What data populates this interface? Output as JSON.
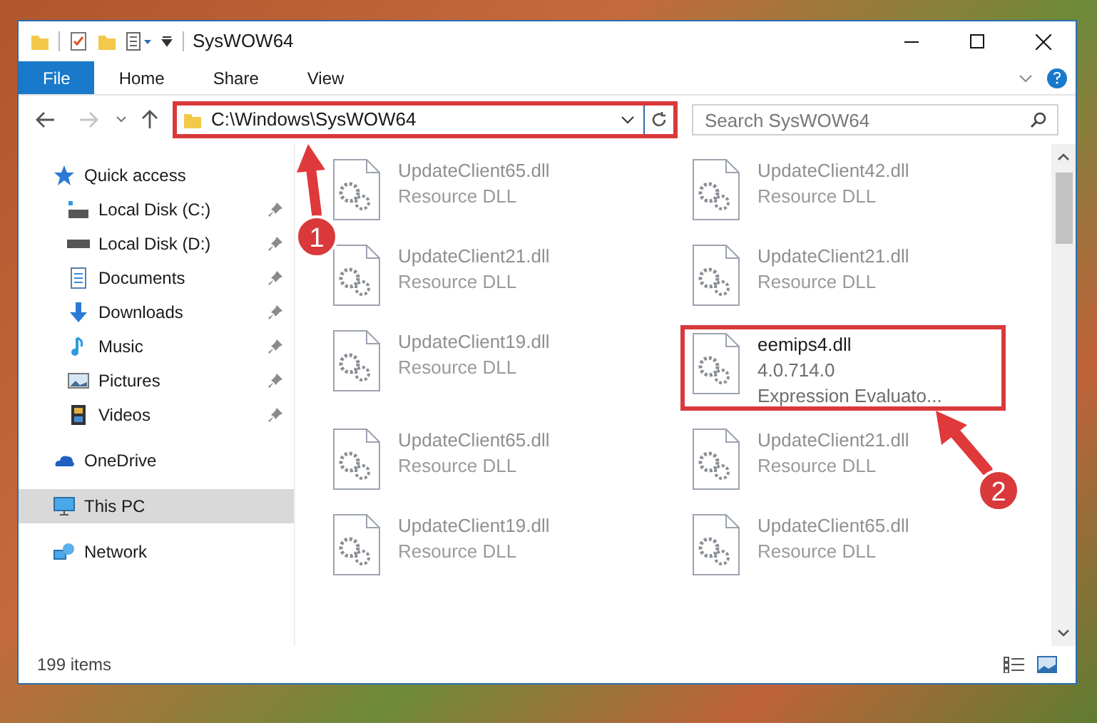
{
  "window": {
    "title": "SysWOW64"
  },
  "ribbon_tabs": [
    {
      "label": "File",
      "selected": true
    },
    {
      "label": "Home",
      "selected": false
    },
    {
      "label": "Share",
      "selected": false
    },
    {
      "label": "View",
      "selected": false
    }
  ],
  "address_bar": {
    "path": "C:\\Windows\\SysWOW64"
  },
  "search": {
    "placeholder": "Search SysWOW64"
  },
  "sidebar": {
    "items": [
      {
        "label": "Quick access",
        "kind": "star",
        "selected": false,
        "children": [
          {
            "label": "Local Disk (C:)",
            "kind": "drive-c",
            "pinned": true,
            "selected": false
          },
          {
            "label": "Local Disk (D:)",
            "kind": "drive",
            "pinned": true,
            "selected": false
          },
          {
            "label": "Documents",
            "kind": "documents",
            "pinned": true,
            "selected": false
          },
          {
            "label": "Downloads",
            "kind": "downloads",
            "pinned": true,
            "selected": false
          },
          {
            "label": "Music",
            "kind": "music",
            "pinned": true,
            "selected": false
          },
          {
            "label": "Pictures",
            "kind": "pictures",
            "pinned": true,
            "selected": false
          },
          {
            "label": "Videos",
            "kind": "videos",
            "pinned": true,
            "selected": false
          }
        ]
      },
      {
        "label": "OneDrive",
        "kind": "cloud",
        "selected": false
      },
      {
        "label": "This PC",
        "kind": "pc",
        "selected": true
      },
      {
        "label": "Network",
        "kind": "network",
        "selected": false
      }
    ]
  },
  "files": [
    {
      "name": "UpdateClient65.dll",
      "details": [
        "Resource DLL"
      ],
      "blurred": true
    },
    {
      "name": "UpdateClient42.dll",
      "details": [
        "Resource DLL"
      ],
      "blurred": true
    },
    {
      "name": "UpdateClient21.dll",
      "details": [
        "Resource DLL"
      ],
      "blurred": true
    },
    {
      "name": "UpdateClient21.dll",
      "details": [
        "Resource DLL"
      ],
      "blurred": true
    },
    {
      "name": "UpdateClient19.dll",
      "details": [
        "Resource DLL"
      ],
      "blurred": true
    },
    {
      "name": "eemips4.dll",
      "details": [
        "4.0.714.0",
        "Expression Evaluato..."
      ],
      "blurred": false
    },
    {
      "name": "UpdateClient65.dll",
      "details": [
        "Resource DLL"
      ],
      "blurred": true
    },
    {
      "name": "UpdateClient21.dll",
      "details": [
        "Resource DLL"
      ],
      "blurred": true
    },
    {
      "name": "UpdateClient19.dll",
      "details": [
        "Resource DLL"
      ],
      "blurred": true
    },
    {
      "name": "UpdateClient65.dll",
      "details": [
        "Resource DLL"
      ],
      "blurred": true
    }
  ],
  "status_bar": {
    "item_count": "199 items"
  },
  "annotations": [
    {
      "number": "1"
    },
    {
      "number": "2"
    }
  ]
}
